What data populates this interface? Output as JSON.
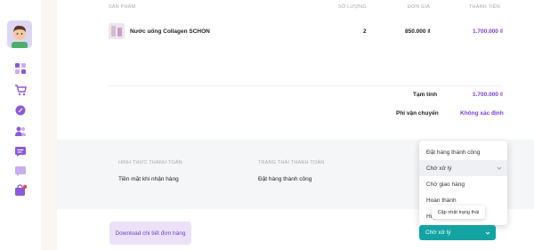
{
  "order_table": {
    "headers": {
      "product": "SẢN PHẨM",
      "quantity": "SỐ LƯỢNG",
      "unit_price": "ĐƠN GIÁ",
      "total": "THÀNH TIỀN"
    },
    "rows": [
      {
        "product_name": "Nước uống Collagen SCHON",
        "quantity": "2",
        "unit_price": "850.000 ₫",
        "total": "1.700.000 ₫"
      }
    ]
  },
  "summary": {
    "subtotal_label": "Tạm tính",
    "subtotal_value": "1.700.000 ₫",
    "shipping_label": "Phí vận chuyển",
    "shipping_value": "Không xác định"
  },
  "payment": {
    "method_header": "HÌNH THỨC THANH TOÁN",
    "method_value": "Tiền mặt khi nhận hàng",
    "status_header": "TRẠNG THÁI THANH TOÁN",
    "status_value": "Đặt hàng thành công"
  },
  "download_button": "Download chi tiết đơn hàng",
  "status_dropdown": {
    "options": [
      "Đặt hàng thành công",
      "Chờ xử lý",
      "Chờ giao hàng",
      "Hoàn thành",
      "Hủy"
    ],
    "selected": "Chờ xử lý",
    "tooltip": "Cập nhật trạng thái"
  },
  "colors": {
    "accent_purple": "#7a3fd1",
    "select_teal": "#14a3a3",
    "notification_red": "#e5484d"
  },
  "sidebar_icons": [
    "dashboard-icon",
    "cart-icon",
    "tag-icon",
    "users-icon",
    "message-icon",
    "chat-icon",
    "bag-icon"
  ]
}
